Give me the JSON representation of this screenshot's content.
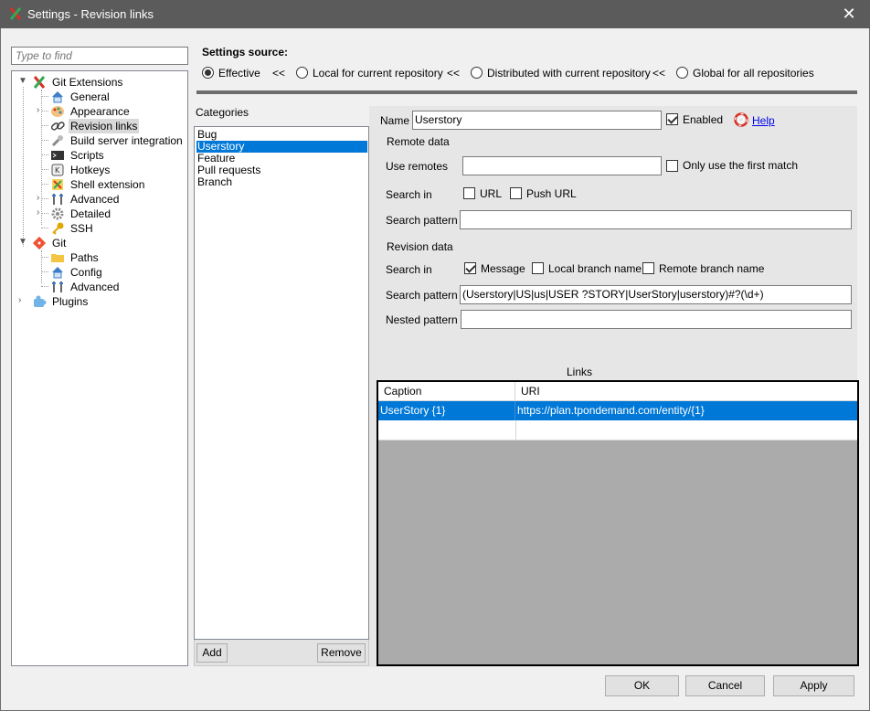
{
  "window": {
    "title": "Settings - Revision links",
    "close_glyph": "✕"
  },
  "search": {
    "placeholder": "Type to find"
  },
  "tree": {
    "items": [
      {
        "label": "Git Extensions",
        "icon": "git-extensions-icon"
      },
      {
        "label": "General",
        "icon": "home-icon"
      },
      {
        "label": "Appearance",
        "icon": "palette-icon"
      },
      {
        "label": "Revision links",
        "icon": "link-icon"
      },
      {
        "label": "Build server integration",
        "icon": "build-icon"
      },
      {
        "label": "Scripts",
        "icon": "console-icon"
      },
      {
        "label": "Hotkeys",
        "icon": "keyboard-icon"
      },
      {
        "label": "Shell extension",
        "icon": "shell-icon"
      },
      {
        "label": "Advanced",
        "icon": "tools-icon"
      },
      {
        "label": "Detailed",
        "icon": "gear-icon"
      },
      {
        "label": "SSH",
        "icon": "key-icon"
      },
      {
        "label": "Git",
        "icon": "git-icon"
      },
      {
        "label": "Paths",
        "icon": "folder-icon"
      },
      {
        "label": "Config",
        "icon": "home-icon"
      },
      {
        "label": "Advanced",
        "icon": "tools-icon"
      },
      {
        "label": "Plugins",
        "icon": "puzzle-icon"
      }
    ]
  },
  "settings_source": {
    "title": "Settings source:",
    "separator": "<<",
    "options": [
      {
        "label": "Effective",
        "selected": true
      },
      {
        "label": "Local for current repository",
        "selected": false
      },
      {
        "label": "Distributed with current repository",
        "selected": false
      },
      {
        "label": "Global for all repositories",
        "selected": false
      }
    ]
  },
  "categories": {
    "label": "Categories",
    "items": [
      "Bug",
      "Userstory",
      "Feature",
      "Pull requests",
      "Branch"
    ],
    "selected_index": 1,
    "add_label": "Add",
    "remove_label": "Remove"
  },
  "details": {
    "name_label": "Name",
    "name_value": "Userstory",
    "enabled_label": "Enabled",
    "enabled": true,
    "help_label": "Help",
    "remote_data_label": "Remote data",
    "use_remotes_label": "Use remotes",
    "use_remotes_value": "",
    "first_match_label": "Only use the first match",
    "remote_search_in_label": "Search in",
    "url_label": "URL",
    "push_url_label": "Push URL",
    "remote_search_pattern_label": "Search pattern",
    "remote_search_pattern_value": "",
    "revision_data_label": "Revision data",
    "revision_search_in_label": "Search in",
    "message_label": "Message",
    "message_checked": true,
    "local_branch_label": "Local branch name",
    "remote_branch_label": "Remote branch name",
    "revision_search_pattern_label": "Search pattern",
    "revision_search_pattern_value": "(Userstory|US|us|USER ?STORY|UserStory|userstory)#?(\\d+)",
    "nested_pattern_label": "Nested pattern",
    "nested_pattern_value": ""
  },
  "links": {
    "title": "Links",
    "columns": [
      "Caption",
      "URI"
    ],
    "rows": [
      {
        "caption": "UserStory {1}",
        "uri": "https://plan.tpondemand.com/entity/{1}"
      }
    ]
  },
  "footer": {
    "ok_label": "OK",
    "cancel_label": "Cancel",
    "apply_label": "Apply"
  },
  "colors": {
    "selection": "#0078d7",
    "title_bar": "#5b5b5b",
    "link": "#0000ee"
  }
}
